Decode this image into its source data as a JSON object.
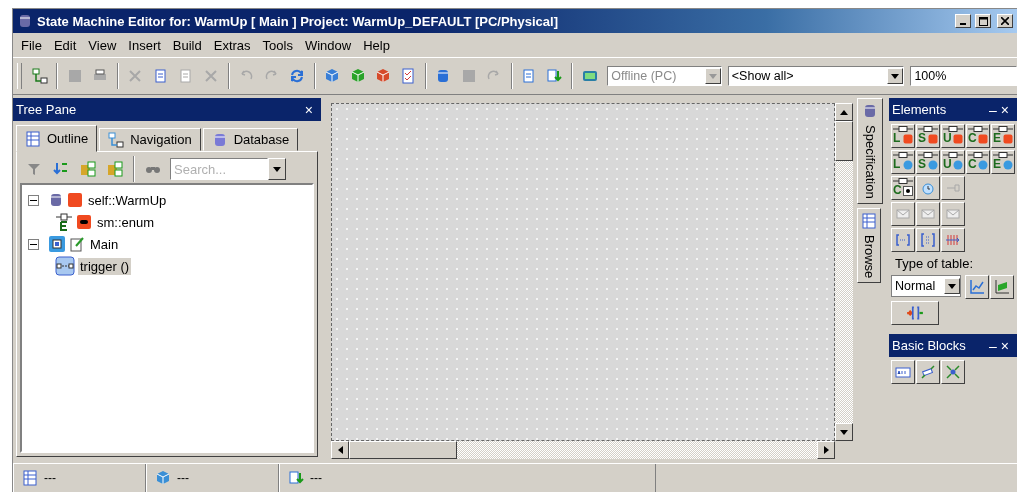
{
  "window": {
    "title": "State Machine Editor for: WarmUp [ Main ] Project: WarmUp_DEFAULT [PC/Physical]"
  },
  "menu": [
    "File",
    "Edit",
    "View",
    "Insert",
    "Build",
    "Extras",
    "Tools",
    "Window",
    "Help"
  ],
  "toolbar": {
    "groups": [
      [
        {
          "kind": "diagram",
          "disabled": false
        }
      ],
      [
        {
          "kind": "save",
          "disabled": true
        },
        {
          "kind": "print",
          "disabled": false
        }
      ],
      [
        {
          "kind": "cut",
          "disabled": true
        },
        {
          "kind": "copy",
          "disabled": false
        },
        {
          "kind": "paste",
          "disabled": true
        },
        {
          "kind": "delete",
          "disabled": true
        }
      ],
      [
        {
          "kind": "undo",
          "disabled": true
        },
        {
          "kind": "redo",
          "disabled": true
        },
        {
          "kind": "refresh",
          "disabled": false
        }
      ],
      [
        {
          "kind": "generate",
          "disabled": false
        },
        {
          "kind": "generate-down",
          "disabled": false
        },
        {
          "kind": "generate-all",
          "disabled": false
        },
        {
          "kind": "checklist",
          "disabled": false
        }
      ],
      [
        {
          "kind": "add-database",
          "disabled": false
        },
        {
          "kind": "add-block",
          "disabled": true
        },
        {
          "kind": "export",
          "disabled": true
        }
      ],
      [
        {
          "kind": "import",
          "disabled": false
        },
        {
          "kind": "download",
          "disabled": false
        }
      ],
      [
        {
          "kind": "monitor",
          "disabled": false
        }
      ]
    ],
    "mode_combo": {
      "value": "Offline (PC)",
      "disabled": true
    },
    "filter_combo": {
      "value": "<Show all>",
      "disabled": false
    },
    "zoom_field": {
      "value": "100%"
    }
  },
  "tree_pane": {
    "title": "Tree Pane",
    "close": "×",
    "tabs": [
      {
        "label": "Outline",
        "kind": "outline",
        "selected": true
      },
      {
        "label": "Navigation",
        "kind": "navigation",
        "selected": false
      },
      {
        "label": "Database",
        "kind": "database",
        "selected": false
      }
    ],
    "search": {
      "placeholder": "Search..."
    },
    "tree": [
      {
        "label": "self::WarmUp",
        "kind": "machine",
        "expanded": true,
        "selected": false,
        "children": [
          {
            "label": "sm::enum",
            "kind": "enum",
            "selected": false
          }
        ]
      },
      {
        "label": "Main",
        "kind": "chart",
        "expanded": true,
        "selected": false,
        "children": [
          {
            "label": "trigger ()",
            "kind": "event",
            "selected": true
          }
        ]
      }
    ]
  },
  "side_tabs": [
    {
      "label": "Specification",
      "kind": "specification",
      "selected": true
    },
    {
      "label": "Browse",
      "kind": "browse",
      "selected": false
    }
  ],
  "elements": {
    "title": "Elements",
    "minimize": "–",
    "close": "×",
    "rows": [
      [
        {
          "letter": "L",
          "kind": "square",
          "disabled": false
        },
        {
          "letter": "S",
          "kind": "square",
          "disabled": false
        },
        {
          "letter": "U",
          "kind": "square",
          "disabled": false
        },
        {
          "letter": "C",
          "kind": "square",
          "disabled": false
        },
        {
          "letter": "E",
          "kind": "square",
          "disabled": false
        }
      ],
      [
        {
          "letter": "L",
          "kind": "circle",
          "disabled": false
        },
        {
          "letter": "S",
          "kind": "circle",
          "disabled": false
        },
        {
          "letter": "U",
          "kind": "circle",
          "disabled": false
        },
        {
          "letter": "C",
          "kind": "circle",
          "disabled": false
        },
        {
          "letter": "E",
          "kind": "circle",
          "disabled": false
        }
      ],
      [
        {
          "letter": "C",
          "kind": "dot",
          "disabled": false
        },
        {
          "kind": "clock",
          "disabled": false
        },
        {
          "kind": "plug",
          "disabled": true
        }
      ],
      [
        {
          "kind": "mail-in",
          "disabled": true
        },
        {
          "kind": "mail",
          "disabled": true
        },
        {
          "kind": "mail-out",
          "disabled": true
        }
      ],
      [
        {
          "kind": "bracket",
          "disabled": false
        },
        {
          "kind": "matrix",
          "disabled": false
        },
        {
          "kind": "bars",
          "disabled": false
        }
      ]
    ],
    "table_label": "Type of table:",
    "table_combo": {
      "value": "Normal"
    },
    "table_buttons": [
      {
        "kind": "chart"
      },
      {
        "kind": "surface"
      }
    ],
    "io_button": {
      "kind": "io"
    }
  },
  "basic_blocks": {
    "title": "Basic Blocks",
    "minimize": "–",
    "close": "×",
    "buttons": [
      {
        "kind": "text"
      },
      {
        "kind": "line"
      },
      {
        "kind": "node"
      }
    ]
  },
  "status_bar": [
    {
      "kind": "outline",
      "text": "---"
    },
    {
      "kind": "network",
      "text": "---"
    },
    {
      "kind": "download",
      "text": "---"
    }
  ]
}
